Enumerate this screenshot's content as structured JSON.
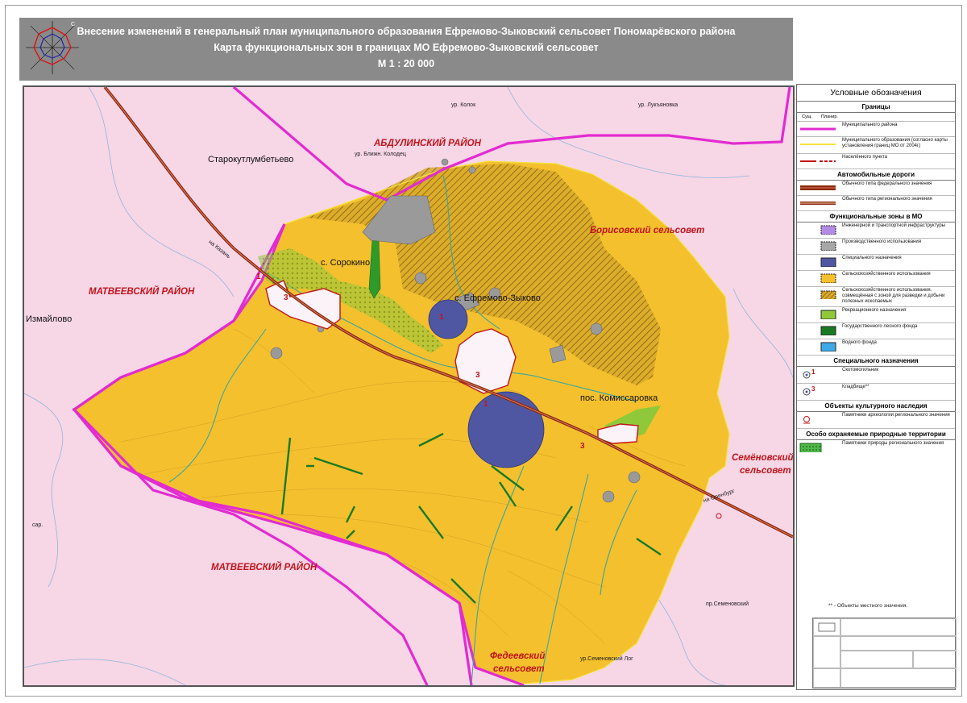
{
  "header": {
    "title_line1": "Внесение изменений в генеральный план муниципального образования Ефремово-Зыковский сельсовет Пономарёвского района",
    "title_line2": "Карта функциональных  зон  в  границах   МО Ефремово-Зыковский сельсовет",
    "scale": "М 1 : 20 000"
  },
  "map": {
    "district_labels": [
      "АБДУЛИНСКИЙ РАЙОН",
      "МАТВЕЕВСКИЙ РАЙОН",
      "МАТВЕЕВСКИЙ РАЙОН",
      "Борисовский сельсовет",
      "Семёновский",
      "сельсовет",
      "Федеевский",
      "сельсовет"
    ],
    "settlements": [
      "Старокутлумбетьево",
      "с. Сорокино",
      "с. Ефремово-Зыково",
      "пос. Комиссаровка",
      "Измайлово"
    ],
    "small_labels": [
      "ур. Колок",
      "ур. Лукъяновка",
      "ур. Ближн. Колодец",
      "пр.Семеновский",
      "ур.Семеновский Лог",
      "сар.",
      "на Казань",
      "на Оренбург"
    ],
    "markers": [
      "1",
      "3",
      "3",
      "1",
      "3",
      "3"
    ]
  },
  "legend": {
    "title": "Условные обозначения",
    "sections": {
      "borders": "Границы",
      "roads": "Автомобильные дороги",
      "zones": "Функциональные зоны в МО",
      "special": "Специального назначения",
      "heritage": "Объекты культурного наследия",
      "protected": "Особо охраняемые природные территории"
    },
    "col_existing": "Сущ.",
    "col_planned": "Планир.",
    "border_items": [
      "Муниципального района",
      "Муниципального образования (согласно карты установления границ МО от 2004г)",
      "Населённого пункта"
    ],
    "road_items": [
      "Обычного типа федерального значения",
      "Обычного типа регионального значения"
    ],
    "zone_items": [
      "Инженерной и транспортной инфраструктуры",
      "Производственного использования",
      "Специального назначения",
      "Сельскохозяйственного использования",
      "Сельскохозяйственного использования, совмещённая с зоной для разведки и добычи полезных ископаемых",
      "Рекреационного назначения",
      "Государственного лесного фонда",
      "Водного  фонда"
    ],
    "special_items": [
      "Скотомогильник",
      "Кладбище**"
    ],
    "heritage_items": [
      "Памятники археологии регионального значения"
    ],
    "protected_items": [
      "Памятники природы регионального значения"
    ],
    "special_numbers": [
      "1",
      "3"
    ]
  },
  "note": "** - Объекты местного значения.",
  "colors": {
    "agri": "#f4c02e",
    "mining_hatch": "#b88a17",
    "special": "#4f57a3",
    "recreation": "#8fc93a",
    "forest": "#1a7a24",
    "water": "#3fa9e8",
    "background": "#f7d6e6",
    "district_border": "#e22bd1",
    "road": "#8b2a12"
  }
}
